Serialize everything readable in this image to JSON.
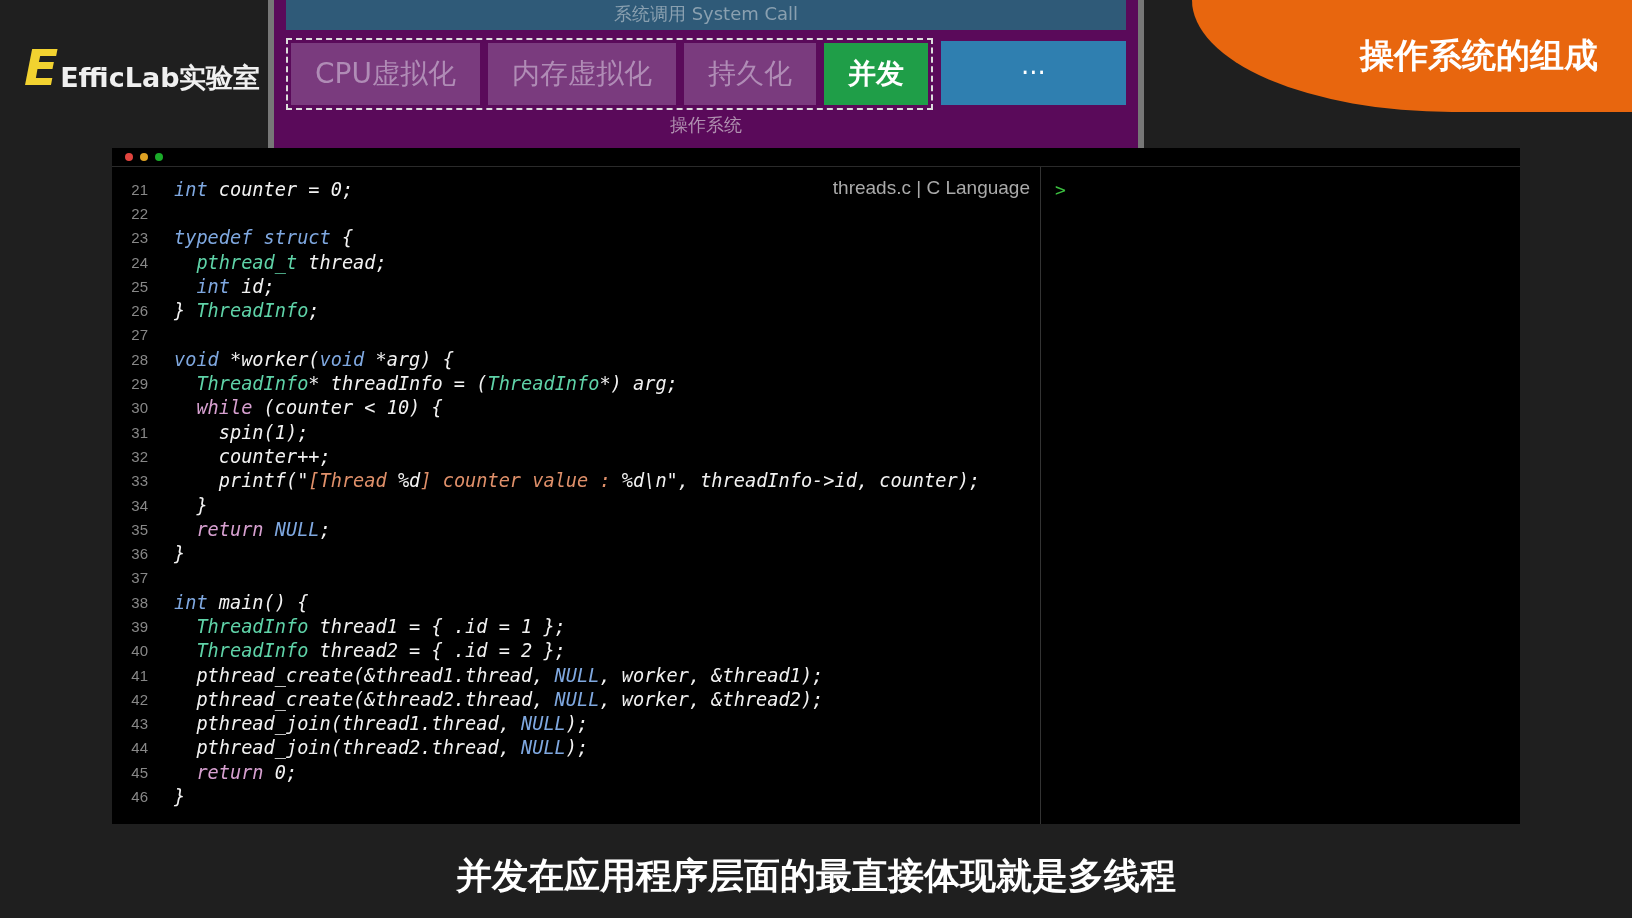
{
  "logo": {
    "mark": "E",
    "text": "EfficLab实验室"
  },
  "slide": {
    "top_bar": "系统调用 System Call",
    "tabs": [
      {
        "label": "CPU虚拟化",
        "selected": false
      },
      {
        "label": "内存虚拟化",
        "selected": false
      },
      {
        "label": "持久化",
        "selected": false
      },
      {
        "label": "并发",
        "selected": true
      }
    ],
    "more_button": "···",
    "footer_label": "操作系统"
  },
  "banner": "操作系统的组成",
  "editor": {
    "file_label": "threads.c | C Language",
    "console_prompt": ">",
    "lines": [
      {
        "number": "21",
        "tokens": [
          {
            "kind": "kw",
            "text": "int"
          },
          {
            "kind": "plain",
            "text": " counter = 0;"
          }
        ]
      },
      {
        "number": "22"
      },
      {
        "number": "23",
        "tokens": [
          {
            "kind": "kw",
            "text": "typedef struct"
          },
          {
            "kind": "plain",
            "text": " {"
          }
        ]
      },
      {
        "number": "24",
        "tokens": [
          {
            "kind": "type",
            "text": "  pthread_t"
          },
          {
            "kind": "plain",
            "text": " thread;"
          }
        ]
      },
      {
        "number": "25",
        "tokens": [
          {
            "kind": "kw",
            "text": "  int"
          },
          {
            "kind": "plain",
            "text": " id;"
          }
        ]
      },
      {
        "number": "26",
        "tokens": [
          {
            "kind": "plain",
            "text": "} "
          },
          {
            "kind": "type",
            "text": "ThreadInfo"
          },
          {
            "kind": "plain",
            "text": ";"
          }
        ]
      },
      {
        "number": "27"
      },
      {
        "number": "28",
        "tokens": [
          {
            "kind": "kw",
            "text": "void"
          },
          {
            "kind": "plain",
            "text": " *worker("
          },
          {
            "kind": "kw",
            "text": "void"
          },
          {
            "kind": "plain",
            "text": " *arg) {"
          }
        ]
      },
      {
        "number": "29",
        "tokens": [
          {
            "kind": "type",
            "text": "  ThreadInfo"
          },
          {
            "kind": "plain",
            "text": "* threadInfo = ("
          },
          {
            "kind": "type",
            "text": "ThreadInfo"
          },
          {
            "kind": "plain",
            "text": "*) arg;"
          }
        ]
      },
      {
        "number": "30",
        "tokens": [
          {
            "kind": "ctl",
            "text": "  while"
          },
          {
            "kind": "plain",
            "text": " (counter < 10) {"
          }
        ]
      },
      {
        "number": "31",
        "tokens": [
          {
            "kind": "plain",
            "text": "    spin(1);"
          }
        ]
      },
      {
        "number": "32",
        "tokens": [
          {
            "kind": "plain",
            "text": "    counter++;"
          }
        ]
      },
      {
        "number": "33",
        "tokens": [
          {
            "kind": "plain",
            "text": "    printf(\""
          },
          {
            "kind": "str",
            "text": "[Thread "
          },
          {
            "kind": "plain",
            "text": "%d"
          },
          {
            "kind": "str",
            "text": "] counter value : "
          },
          {
            "kind": "plain",
            "text": "%d\\n\", threadInfo->id, counter);"
          }
        ]
      },
      {
        "number": "34",
        "tokens": [
          {
            "kind": "plain",
            "text": "  }"
          }
        ]
      },
      {
        "number": "35",
        "tokens": [
          {
            "kind": "ctl",
            "text": "  return"
          },
          {
            "kind": "kw",
            "text": " NULL"
          },
          {
            "kind": "plain",
            "text": ";"
          }
        ]
      },
      {
        "number": "36",
        "tokens": [
          {
            "kind": "plain",
            "text": "}"
          }
        ]
      },
      {
        "number": "37"
      },
      {
        "number": "38",
        "tokens": [
          {
            "kind": "kw",
            "text": "int"
          },
          {
            "kind": "plain",
            "text": " main() {"
          }
        ]
      },
      {
        "number": "39",
        "tokens": [
          {
            "kind": "type",
            "text": "  ThreadInfo"
          },
          {
            "kind": "plain",
            "text": " thread1 = { .id = 1 };"
          }
        ]
      },
      {
        "number": "40",
        "tokens": [
          {
            "kind": "type",
            "text": "  ThreadInfo"
          },
          {
            "kind": "plain",
            "text": " thread2 = { .id = 2 };"
          }
        ]
      },
      {
        "number": "41",
        "tokens": [
          {
            "kind": "plain",
            "text": "  pthread_create(&thread1.thread, "
          },
          {
            "kind": "kw",
            "text": "NULL"
          },
          {
            "kind": "plain",
            "text": ", worker, &thread1);"
          }
        ]
      },
      {
        "number": "42",
        "tokens": [
          {
            "kind": "plain",
            "text": "  pthread_create(&thread2.thread, "
          },
          {
            "kind": "kw",
            "text": "NULL"
          },
          {
            "kind": "plain",
            "text": ", worker, &thread2);"
          }
        ]
      },
      {
        "number": "43",
        "tokens": [
          {
            "kind": "plain",
            "text": "  pthread_join(thread1.thread, "
          },
          {
            "kind": "kw",
            "text": "NULL"
          },
          {
            "kind": "plain",
            "text": ");"
          }
        ]
      },
      {
        "number": "44",
        "tokens": [
          {
            "kind": "plain",
            "text": "  pthread_join(thread2.thread, "
          },
          {
            "kind": "kw",
            "text": "NULL"
          },
          {
            "kind": "plain",
            "text": ");"
          }
        ]
      },
      {
        "number": "45",
        "tokens": [
          {
            "kind": "ctl",
            "text": "  return"
          },
          {
            "kind": "plain",
            "text": " 0;"
          }
        ]
      },
      {
        "number": "46",
        "tokens": [
          {
            "kind": "plain",
            "text": "}"
          }
        ]
      }
    ]
  },
  "subtitle": "并发在应用程序层面的最直接体现就是多线程"
}
